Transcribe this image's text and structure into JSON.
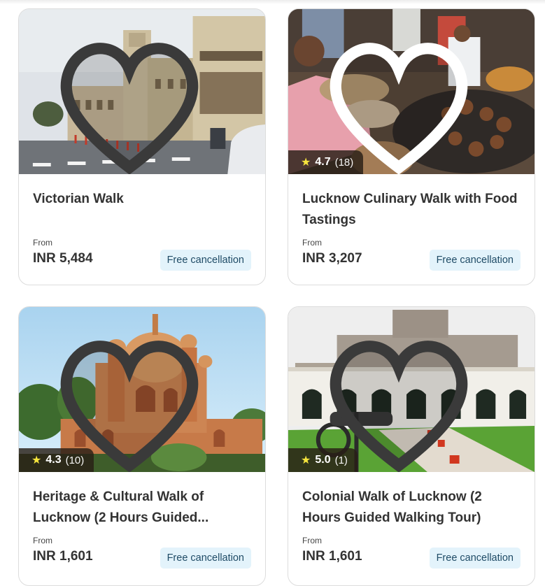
{
  "cards": [
    {
      "title": "Victorian Walk",
      "from_label": "From",
      "price": "INR 5,484",
      "badge": "Free cancellation",
      "rating": null,
      "reviews": null
    },
    {
      "title": "Lucknow Culinary Walk with Food Tastings",
      "from_label": "From",
      "price": "INR 3,207",
      "badge": "Free cancellation",
      "rating": "4.7",
      "reviews": "(18)"
    },
    {
      "title": "Heritage & Cultural Walk of Lucknow (2 Hours Guided...",
      "from_label": "From",
      "price": "INR 1,601",
      "badge": "Free cancellation",
      "rating": "4.3",
      "reviews": "(10)"
    },
    {
      "title": "Colonial Walk of Lucknow (2 Hours Guided Walking Tour)",
      "from_label": "From",
      "price": "INR 1,601",
      "badge": "Free cancellation",
      "rating": "5.0",
      "reviews": "(1)"
    }
  ],
  "icons": {
    "favorite": "heart-icon",
    "rating": "star-icon"
  },
  "colors": {
    "badge_bg": "#e3f3fb",
    "badge_text": "#1f4b66",
    "star": "#f6e53d"
  }
}
